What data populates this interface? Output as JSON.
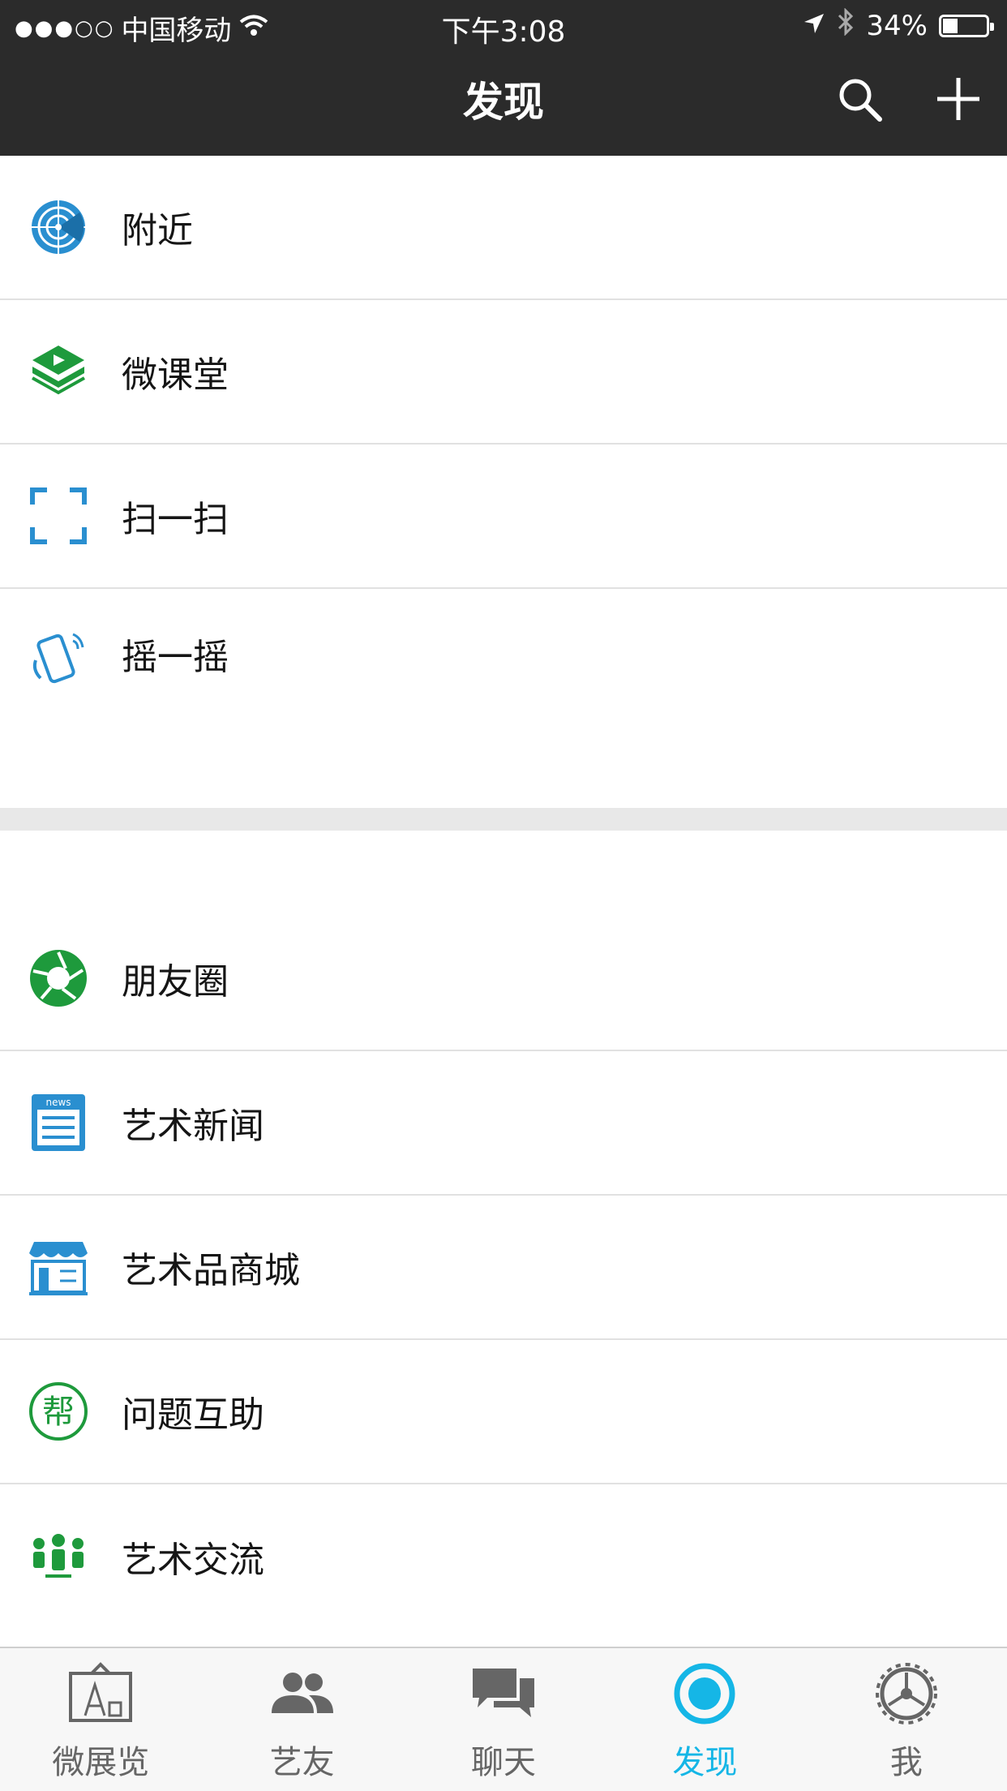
{
  "status_bar": {
    "carrier": "中国移动",
    "signal_dots": "●●●○○",
    "time": "下午3:08",
    "battery_percent": "34%",
    "battery_level": 0.34
  },
  "nav": {
    "title": "发现"
  },
  "menu": {
    "items": [
      {
        "label": "附近",
        "icon": "radar-icon"
      },
      {
        "label": "微课堂",
        "icon": "book-play-icon"
      },
      {
        "label": "扫一扫",
        "icon": "scan-frame-icon"
      },
      {
        "label": "摇一摇",
        "icon": "shake-phone-icon"
      },
      {
        "label": "朋友圈",
        "icon": "aperture-icon"
      },
      {
        "label": "艺术新闻",
        "icon": "news-icon"
      },
      {
        "label": "艺术品商城",
        "icon": "shop-icon"
      },
      {
        "label": "问题互助",
        "icon": "help-badge-icon"
      },
      {
        "label": "艺术交流",
        "icon": "people-group-icon"
      }
    ],
    "help_badge_text": "帮",
    "news_badge_text": "news"
  },
  "tabbar": {
    "tabs": [
      {
        "label": "微展览",
        "icon": "easel-icon"
      },
      {
        "label": "艺友",
        "icon": "friends-icon"
      },
      {
        "label": "聊天",
        "icon": "chat-bubbles-icon"
      },
      {
        "label": "发现",
        "icon": "discover-icon",
        "active": true
      },
      {
        "label": "我",
        "icon": "gear-icon"
      }
    ]
  },
  "colors": {
    "header_bg": "#2b2b2b",
    "active_tab": "#15b6e6",
    "icon_blue": "#2a8fd0",
    "icon_green": "#1e9a3c"
  }
}
